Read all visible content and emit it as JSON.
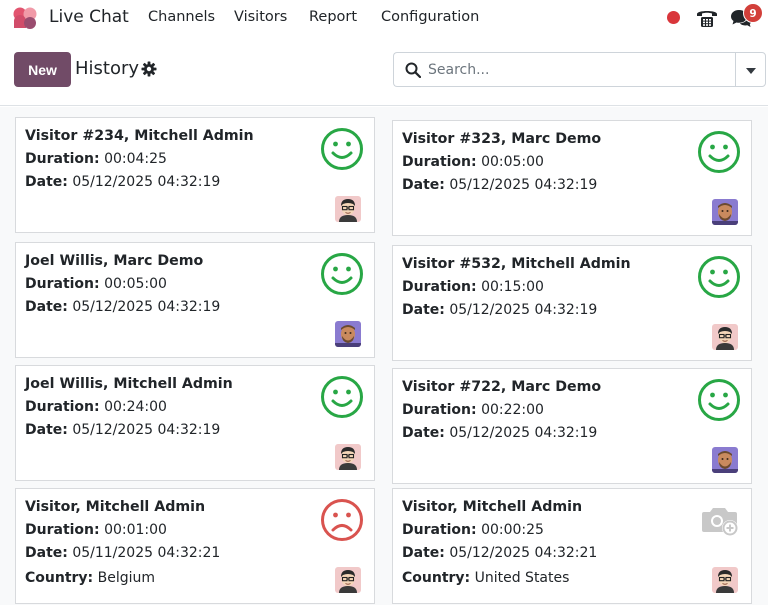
{
  "app": {
    "name": "Live Chat"
  },
  "nav": {
    "menu": [
      "Channels",
      "Visitors",
      "Report",
      "Configuration"
    ],
    "notification_count": "9"
  },
  "control": {
    "new_label": "New",
    "title": "History",
    "search_placeholder": "Search..."
  },
  "labels": {
    "duration": "Duration:",
    "date": "Date:",
    "country": "Country:"
  },
  "cards": [
    {
      "title": "Visitor #234, Mitchell Admin",
      "duration": "00:04:25",
      "date": "05/12/2025 04:32:19",
      "country": "",
      "rating": "happy-face",
      "avatar": "mitchell-admin-avatar"
    },
    {
      "title": "Visitor #323, Marc Demo",
      "duration": "00:05:00",
      "date": "05/12/2025 04:32:19",
      "country": "",
      "rating": "happy-face",
      "avatar": "marc-demo-avatar"
    },
    {
      "title": "Joel Willis, Marc Demo",
      "duration": "00:05:00",
      "date": "05/12/2025 04:32:19",
      "country": "",
      "rating": "happy-face",
      "avatar": "marc-demo-avatar"
    },
    {
      "title": "Visitor #532, Mitchell Admin",
      "duration": "00:15:00",
      "date": "05/12/2025 04:32:19",
      "country": "",
      "rating": "happy-face",
      "avatar": "mitchell-admin-avatar"
    },
    {
      "title": "Joel Willis, Mitchell Admin",
      "duration": "00:24:00",
      "date": "05/12/2025 04:32:19",
      "country": "",
      "rating": "happy-face",
      "avatar": "mitchell-admin-avatar"
    },
    {
      "title": "Visitor #722, Marc Demo",
      "duration": "00:22:00",
      "date": "05/12/2025 04:32:19",
      "country": "",
      "rating": "happy-face",
      "avatar": "marc-demo-avatar"
    },
    {
      "title": "Visitor, Mitchell Admin",
      "duration": "00:01:00",
      "date": "05/11/2025 04:32:21",
      "country": "Belgium",
      "rating": "sad-face",
      "avatar": "mitchell-admin-avatar"
    },
    {
      "title": "Visitor, Mitchell Admin",
      "duration": "00:00:25",
      "date": "05/12/2025 04:32:21",
      "country": "United States",
      "rating": "no-rating-camera",
      "avatar": "mitchell-admin-avatar"
    }
  ],
  "colors": {
    "primary": "#714b67",
    "happy": "#28a745",
    "sad": "#d9534f",
    "none": "#c8c8c8",
    "status": "#d9363b",
    "badge": "#d23f3a"
  }
}
